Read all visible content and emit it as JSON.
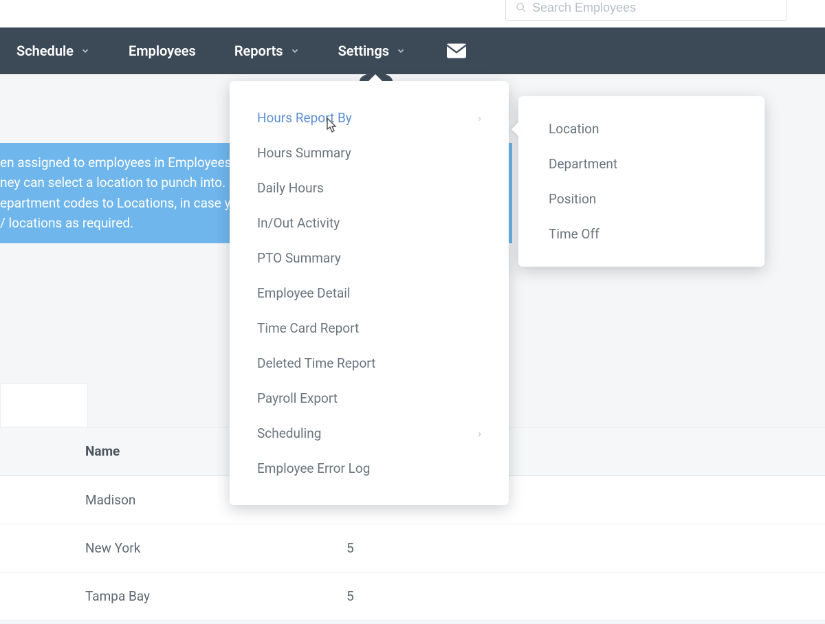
{
  "search": {
    "placeholder": "Search Employees"
  },
  "nav": {
    "schedule": "Schedule",
    "employees": "Employees",
    "reports": "Reports",
    "settings": "Settings"
  },
  "banner": {
    "line1": "en assigned to employees in Employees",
    "line2": "ney can select a location to punch into.",
    "line3": "epartment codes to Locations, in case yo",
    "line4": "/ locations as required."
  },
  "reports_menu": {
    "hours_report_by": "Hours Report By",
    "hours_summary": "Hours Summary",
    "daily_hours": "Daily Hours",
    "in_out_activity": "In/Out Activity",
    "pto_summary": "PTO Summary",
    "employee_detail": "Employee Detail",
    "time_card_report": "Time Card Report",
    "deleted_time_report": "Deleted Time Report",
    "payroll_export": "Payroll Export",
    "scheduling": "Scheduling",
    "employee_error_log": "Employee Error Log"
  },
  "hours_report_by_submenu": {
    "location": "Location",
    "department": "Department",
    "position": "Position",
    "time_off": "Time Off"
  },
  "table": {
    "header_name": "Name",
    "rows": [
      {
        "name": "Madison",
        "count": ""
      },
      {
        "name": "New York",
        "count": "5"
      },
      {
        "name": "Tampa Bay",
        "count": "5"
      }
    ]
  }
}
